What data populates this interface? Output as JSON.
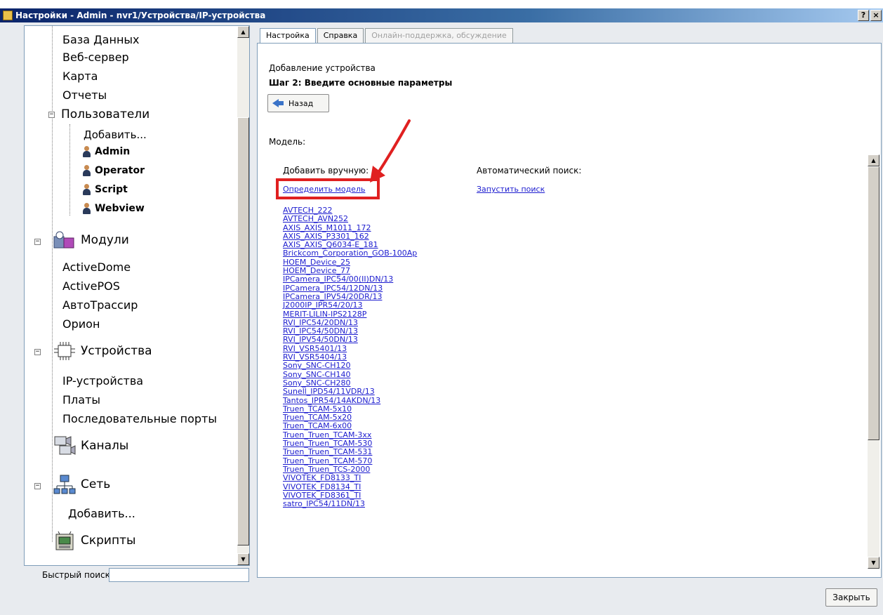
{
  "window": {
    "title": "Настройки - Admin - nvr1/Устройства/IP-устройства",
    "help_btn": "?",
    "close_btn": "×"
  },
  "tree": {
    "items": [
      {
        "label": "База Данных"
      },
      {
        "label": "Веб-сервер"
      },
      {
        "label": "Карта"
      },
      {
        "label": "Отчеты"
      },
      {
        "label": "Пользователи"
      },
      {
        "label": "Добавить..."
      },
      {
        "label": "Admin"
      },
      {
        "label": "Operator"
      },
      {
        "label": "Script"
      },
      {
        "label": "Webview"
      },
      {
        "label": "Модули"
      },
      {
        "label": "ActiveDome"
      },
      {
        "label": "ActivePOS"
      },
      {
        "label": "АвтоТрассир"
      },
      {
        "label": "Орион"
      },
      {
        "label": "Устройства"
      },
      {
        "label": "IP-устройства"
      },
      {
        "label": "Платы"
      },
      {
        "label": "Последовательные порты"
      },
      {
        "label": "Каналы"
      },
      {
        "label": "Сеть"
      },
      {
        "label": "Добавить..."
      },
      {
        "label": "Скрипты"
      }
    ],
    "expander_minus": "−"
  },
  "quick_search": {
    "label": "Быстрый поиск:",
    "value": ""
  },
  "tabs": [
    {
      "label": "Настройка",
      "state": "active"
    },
    {
      "label": "Справка",
      "state": "normal"
    },
    {
      "label": "Онлайн-поддержка, обсуждение",
      "state": "disabled"
    }
  ],
  "content": {
    "heading": "Добавление устройства",
    "step": "Шаг 2: Введите основные параметры",
    "back_label": "Назад",
    "model_label": "Модель:",
    "manual_label": "Добавить вручную:",
    "auto_label": "Автоматический поиск:",
    "detect_model_link": "Определить модель",
    "start_search_link": "Запустить поиск",
    "models": [
      "AVTECH_222",
      "AVTECH_AVN252",
      "AXIS_AXIS_M1011_172",
      "AXIS_AXIS_P3301_162",
      "AXIS_AXIS_Q6034-E_181",
      "Brickcom_Corporation_GOB-100Ap",
      "HOEM_Device_25",
      "HOEM_Device_77",
      "IPCamera_IPC54/00(II)DN/13",
      "IPCamera_IPC54/12DN/13",
      "IPCamera_IPV54/20DR/13",
      "J2000IP_IPR54/20/13",
      "MERIT-LILIN-IPS2128P",
      "RVI_IPC54/20DN/13",
      "RVI_IPC54/50DN/13",
      "RVI_IPV54/50DN/13",
      "RVI_VSR5401/13",
      "RVI_VSR5404/13",
      "Sony_SNC-CH120",
      "Sony_SNC-CH140",
      "Sony_SNC-CH280",
      "Sunell_IPD54/11VDR/13",
      "Tantos_IPR54/14AKDN/13",
      "Truen_TCAM-5x10",
      "Truen_TCAM-5x20",
      "Truen_TCAM-6x00",
      "Truen_Truen_TCAM-3xx",
      "Truen_Truen_TCAM-530",
      "Truen_Truen_TCAM-531",
      "Truen_Truen_TCAM-570",
      "Truen_Truen_TCS-2000",
      "VIVOTEK_FD8133_TI",
      "VIVOTEK_FD8134_TI",
      "VIVOTEK_FD8361_TI",
      "satro_IPC54/11DN/13"
    ]
  },
  "footer": {
    "close_label": "Закрыть"
  },
  "colors": {
    "link": "#1c1ccf",
    "highlight": "#e02020",
    "titlebar": "#0a246a"
  }
}
